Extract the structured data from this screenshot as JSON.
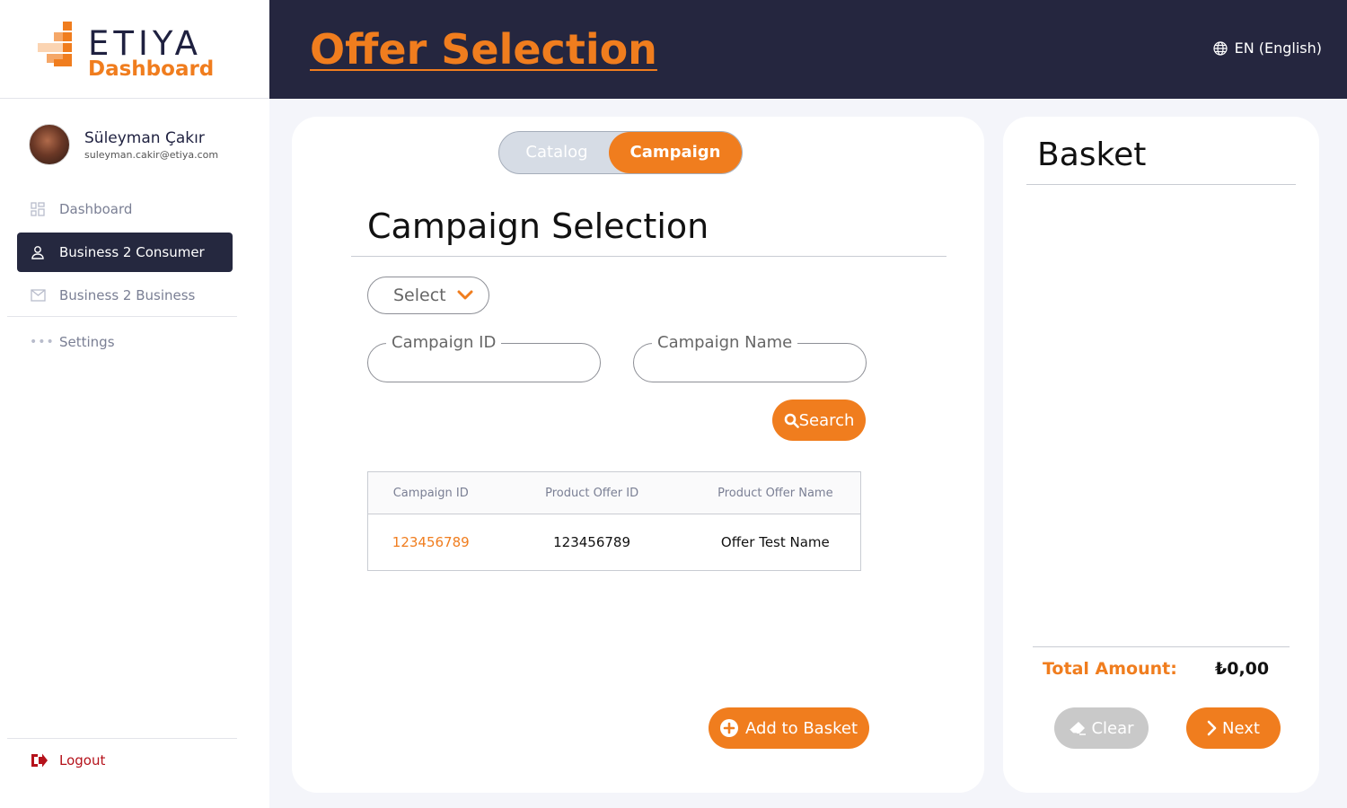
{
  "brand": {
    "name": "ETIYA",
    "subtitle": "Dashboard"
  },
  "user": {
    "name": "Süleyman Çakır",
    "email": "suleyman.cakir@etiya.com"
  },
  "sidebar": {
    "items": [
      {
        "label": "Dashboard",
        "icon": "grid-icon",
        "active": false
      },
      {
        "label": "Business 2 Consumer",
        "icon": "user-icon",
        "active": true
      },
      {
        "label": "Business 2 Business",
        "icon": "mail-icon",
        "active": false
      }
    ],
    "settings": "Settings",
    "logout": "Logout"
  },
  "header": {
    "title": "Offer Selection",
    "language": "EN (English)"
  },
  "tabs": {
    "catalog": "Catalog",
    "campaign": "Campaign",
    "active": "Campaign"
  },
  "campaign": {
    "title": "Campaign Selection",
    "select_label": "Select",
    "campaign_id_label": "Campaign ID",
    "campaign_id_value": "",
    "campaign_name_label": "Campaign Name",
    "campaign_name_value": "",
    "search_label": "Search",
    "add_to_basket_label": "Add to Basket"
  },
  "table": {
    "columns": [
      "Campaign ID",
      "Product Offer ID",
      "Product Offer Name"
    ],
    "rows": [
      [
        "123456789",
        "123456789",
        "Offer Test Name"
      ]
    ]
  },
  "basket": {
    "title": "Basket",
    "total_label": "Total Amount:",
    "total_value": "₺0,00",
    "clear_label": "Clear",
    "next_label": "Next"
  },
  "colors": {
    "accent": "#f07d1e",
    "dark": "#25263f",
    "logout": "#b5121b"
  }
}
